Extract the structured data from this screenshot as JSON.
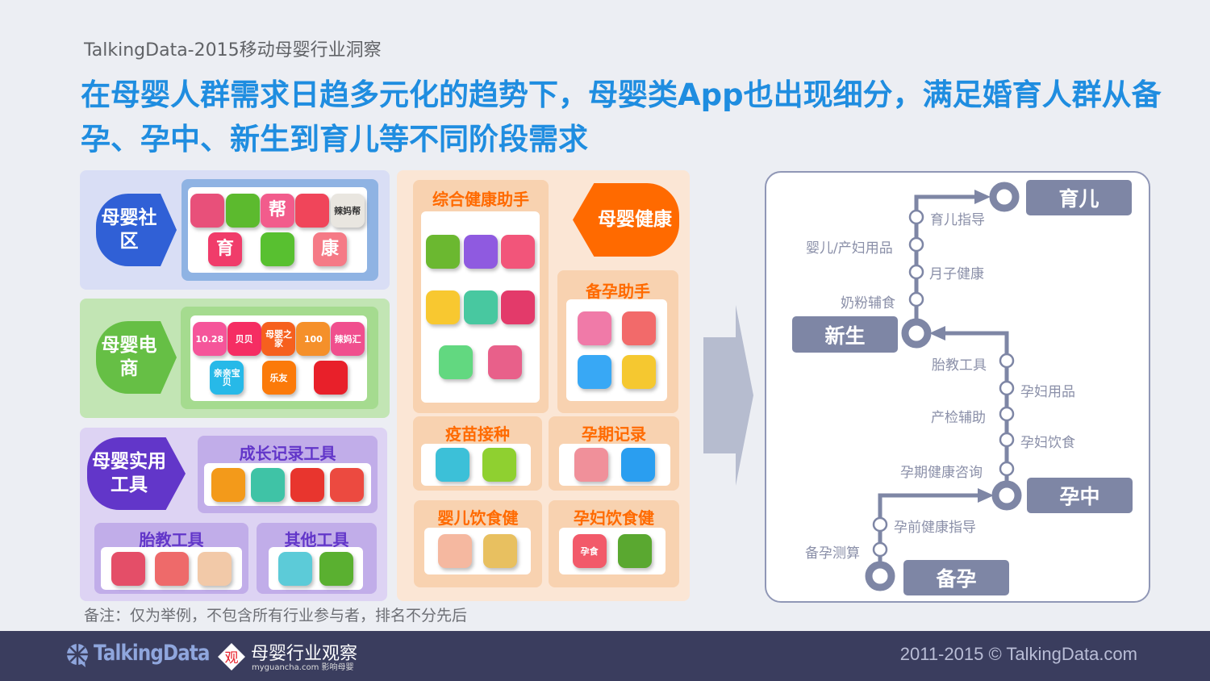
{
  "header": {
    "subtitle": "TalkingData-2015移动母婴行业洞察",
    "headline": "在母婴人群需求日趋多元化的趋势下，母婴类App也出现细分，满足婚育人群从备孕、孕中、新生到育儿等不同阶段需求"
  },
  "colors": {
    "headline": "#1f8de0",
    "community": "#3060d6",
    "ecommerce": "#66bf45",
    "tools": "#6236c9",
    "health": "#ff6a00",
    "metro": "#7e86a5",
    "footer": "#3a3d5e"
  },
  "community": {
    "label": "母婴社区",
    "icons": [
      {
        "color": "#e8507a",
        "text": ""
      },
      {
        "color": "#5cba2e",
        "text": ""
      },
      {
        "color": "#f25c8c",
        "text": "帮"
      },
      {
        "color": "#f0455a",
        "text": ""
      },
      {
        "color": "#e9e6e0",
        "text": "辣妈帮",
        "dark": true
      },
      {
        "color": "#f03c6a",
        "text": "育"
      },
      {
        "color": "#58c030",
        "text": ""
      },
      {
        "color": "#f57a86",
        "text": "康"
      }
    ]
  },
  "ecommerce": {
    "label": "母婴电商",
    "icons": [
      {
        "color": "#f5559a",
        "text": "10.28"
      },
      {
        "color": "#f52d63",
        "text": "贝贝"
      },
      {
        "color": "#f6601e",
        "text": "母婴之家"
      },
      {
        "color": "#f5902a",
        "text": "100"
      },
      {
        "color": "#f04f8e",
        "text": "辣妈汇"
      },
      {
        "color": "#27b9e8",
        "text": "亲亲宝贝"
      },
      {
        "color": "#fb7a0a",
        "text": "乐友"
      },
      {
        "color": "#e8202a",
        "text": ""
      }
    ]
  },
  "tools": {
    "label": "母婴实用工具",
    "growth": {
      "title": "成长记录工具",
      "icons": [
        {
          "color": "#f39a1a",
          "text": ""
        },
        {
          "color": "#3fc3a6",
          "text": ""
        },
        {
          "color": "#e8352e",
          "text": ""
        },
        {
          "color": "#ec4a40",
          "text": ""
        }
      ]
    },
    "prenatal": {
      "title": "胎教工具",
      "icons": [
        {
          "color": "#e44e68",
          "text": ""
        },
        {
          "color": "#ee6a6a",
          "text": ""
        },
        {
          "color": "#f2c9a8",
          "text": ""
        }
      ]
    },
    "other": {
      "title": "其他工具",
      "icons": [
        {
          "color": "#5ccbd8",
          "text": ""
        },
        {
          "color": "#5ab030",
          "text": ""
        }
      ]
    }
  },
  "health": {
    "label": "母婴健康",
    "general": {
      "title": "综合健康助手",
      "icons": [
        {
          "color": "#6bb830",
          "text": ""
        },
        {
          "color": "#8f5ae0",
          "text": ""
        },
        {
          "color": "#f2557a",
          "text": ""
        },
        {
          "color": "#f8c830",
          "text": ""
        },
        {
          "color": "#48c8a0",
          "text": ""
        },
        {
          "color": "#e33a6a",
          "text": ""
        },
        {
          "color": "#62d880",
          "text": ""
        },
        {
          "color": "#e8608a",
          "text": ""
        }
      ]
    },
    "preconception": {
      "title": "备孕助手",
      "icons": [
        {
          "color": "#f07aa8",
          "text": ""
        },
        {
          "color": "#f26a6a",
          "text": ""
        },
        {
          "color": "#38a8f5",
          "text": ""
        },
        {
          "color": "#f5c830",
          "text": ""
        }
      ]
    },
    "vaccine": {
      "title": "疫苗接种",
      "icons": [
        {
          "color": "#3cc0d8",
          "text": ""
        },
        {
          "color": "#8fd030",
          "text": ""
        }
      ]
    },
    "pregnancy_record": {
      "title": "孕期记录",
      "icons": [
        {
          "color": "#f0909a",
          "text": ""
        },
        {
          "color": "#2a9ef0",
          "text": ""
        }
      ]
    },
    "baby_diet": {
      "title": "婴儿饮食健",
      "icons": [
        {
          "color": "#f5b8a0",
          "text": ""
        },
        {
          "color": "#e8c060",
          "text": ""
        }
      ]
    },
    "mother_diet": {
      "title": "孕妇饮食健",
      "icons": [
        {
          "color": "#f25a6a",
          "text": "孕食"
        },
        {
          "color": "#5aa830",
          "text": ""
        }
      ]
    }
  },
  "metro": {
    "stages": {
      "prep": "备孕",
      "pregnant": "孕中",
      "newborn": "新生",
      "parenting": "育儿"
    },
    "stations": [
      "备孕测算",
      "孕前健康指导",
      "孕期健康咨询",
      "孕妇饮食",
      "产检辅助",
      "孕妇用品",
      "胎教工具",
      "奶粉辅食",
      "月子健康",
      "婴儿/产妇用品",
      "育儿指导"
    ]
  },
  "note": "备注：仅为举例，不包含所有行业参与者，排名不分先后",
  "footer": {
    "brand": "TalkingData",
    "partner": "母婴行业观察",
    "partner_sub": "myguancha.com 影响母婴",
    "copyright": "2011-2015 © TalkingData.com"
  }
}
